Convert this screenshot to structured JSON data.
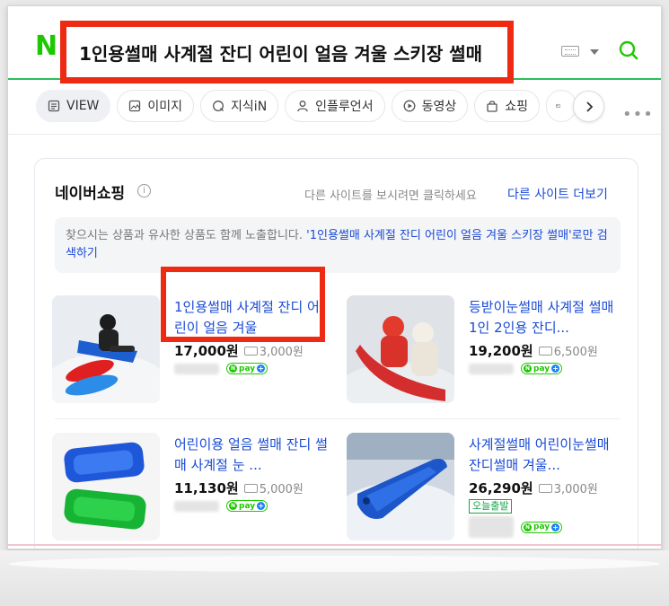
{
  "header": {
    "logo": "N",
    "query": "1인용썰매 사계절 잔디 어린이 얼음 겨울 스키장 썰매"
  },
  "tabs": [
    {
      "label": "VIEW",
      "icon": "document-icon",
      "active": true
    },
    {
      "label": "이미지",
      "icon": "image-icon",
      "active": false
    },
    {
      "label": "지식iN",
      "icon": "qna-icon",
      "active": false
    },
    {
      "label": "인플루언서",
      "icon": "person-icon",
      "active": false
    },
    {
      "label": "동영상",
      "icon": "play-icon",
      "active": false
    },
    {
      "label": "쇼핑",
      "icon": "bag-icon",
      "active": false
    }
  ],
  "shopping": {
    "title": "네이버쇼핑",
    "hint": "다른 사이트를 보시려면 클릭하세요",
    "more_sites": "다른 사이트 더보기",
    "notice_prefix": "찾으시는 상품과 유사한 상품도 함께 노출합니다.",
    "notice_link": "'1인용썰매 사계절 잔디 어린이 얼음 겨울 스키장 썰매'로만 검색하기",
    "items": [
      {
        "title": "1인용썰매 사계절 잔디 어린이 얼음 겨울",
        "price": "17,000원",
        "shipping": "3,000원",
        "npay": "pay",
        "badge": ""
      },
      {
        "title": "등받이눈썰매 사계절 썰매 1인 2인용 잔디...",
        "price": "19,200원",
        "shipping": "6,500원",
        "npay": "pay",
        "badge": ""
      },
      {
        "title": "어린이용 얼음 썰매 잔디 썰매 사계절 눈 ...",
        "price": "11,130원",
        "shipping": "5,000원",
        "npay": "pay",
        "badge": ""
      },
      {
        "title": "사계절썰매 어린이눈썰매 잔디썰매 겨울...",
        "price": "26,290원",
        "shipping": "3,000원",
        "npay": "pay",
        "badge": "오늘출발"
      }
    ]
  },
  "colors": {
    "naver_green": "#1ec800",
    "link_blue": "#1a4ad6",
    "highlight_red": "#ee2a13"
  }
}
